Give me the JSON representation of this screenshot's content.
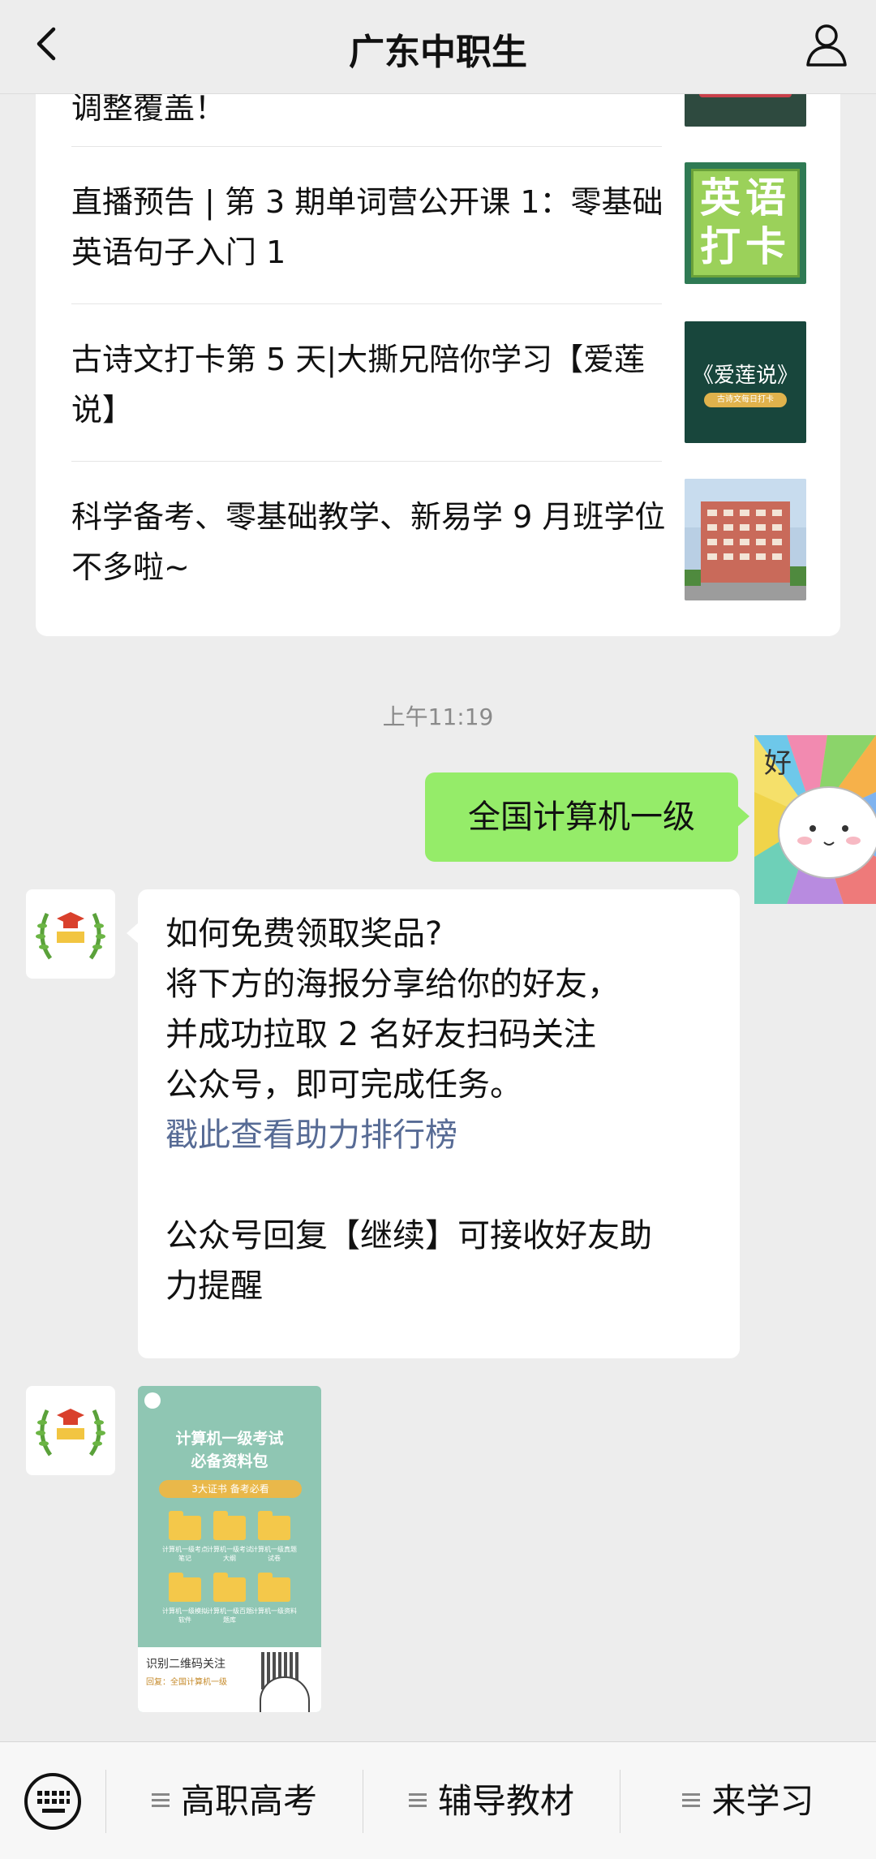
{
  "header": {
    "title": "广东中职生"
  },
  "articles": [
    {
      "title": "调整覆盖！",
      "thumb": "red-cover"
    },
    {
      "title": "直播预告 | 第 3 期单词营公开课 1：零基础英语句子入门 1",
      "thumb_text": "英语打卡"
    },
    {
      "title": "古诗文打卡第 5 天|大撕兄陪你学习【爱莲说】",
      "thumb_text": "《爱莲说》",
      "thumb_sub": "古诗文每日打卡"
    },
    {
      "title": "科学备考、零基础教学、新易学 9 月班学位不多啦~",
      "thumb": "school-building"
    }
  ],
  "chat": {
    "time": "上午11:19",
    "sent_message": "全国计算机一级",
    "sticker_text": "好",
    "reply_lines": [
      "如何免费领取奖品?",
      "将下方的海报分享给你的好友，",
      "并成功拉取 2 名好友扫码关注",
      "公众号，即可完成任务。"
    ],
    "reply_link": "戳此查看助力排行榜",
    "reply_tail_1": "公众号回复【继续】可接收好友助",
    "reply_tail_2": "力提醒",
    "poster": {
      "title_1": "计算机一级考试",
      "title_2": "必备资料包",
      "banner": "3大证书 备考必看",
      "folders": [
        "计算机一级考点笔记",
        "计算机一级考试大纲",
        "计算机一级真题试卷",
        "计算机一级模拟软件",
        "计算机一级百题题库",
        "计算机一级资料"
      ],
      "scan_text": "识别二维码关注",
      "reply_hint": "回复：全国计算机一级"
    }
  },
  "bottom_menu": {
    "items": [
      "高职高考",
      "辅导教材",
      "来学习"
    ]
  },
  "colors": {
    "background": "#ededed",
    "green_bubble": "#95ec69",
    "link": "#576b95"
  }
}
